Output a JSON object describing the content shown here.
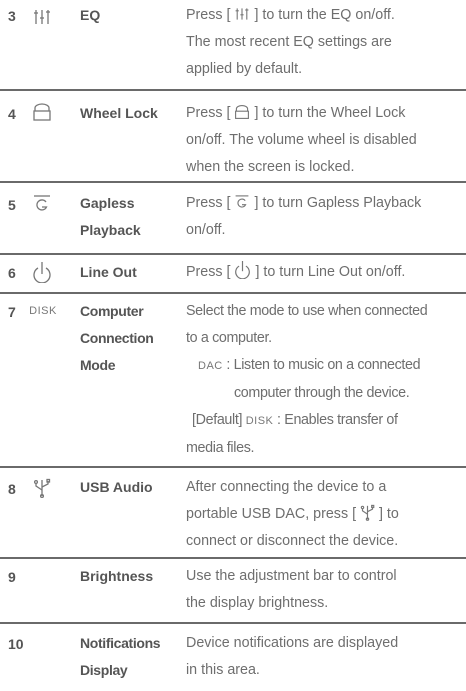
{
  "rows": [
    {
      "number": "3",
      "icon": "eq-icon",
      "label_lines": [
        "EQ"
      ],
      "description_lines": [
        {
          "before": "Press [ ",
          "icon": "eq-icon",
          "after": " ] to turn the EQ on/off."
        },
        {
          "text": "The most recent EQ settings are"
        },
        {
          "text": "applied by default."
        }
      ]
    },
    {
      "number": "4",
      "icon": "lock-icon",
      "label_lines": [
        "Wheel Lock"
      ],
      "description_lines": [
        {
          "before": "Press [ ",
          "icon": "lock-icon",
          "after": " ] to turn the Wheel Lock"
        },
        {
          "text": "on/off. The volume wheel is disabled"
        },
        {
          "text": "when the screen is locked."
        }
      ]
    },
    {
      "number": "5",
      "icon": "gapless-icon",
      "label_lines": [
        "Gapless",
        "Playback"
      ],
      "description_lines": [
        {
          "before": "Press [ ",
          "icon": "gapless-icon",
          "after": " ] to turn Gapless Playback"
        },
        {
          "text": "on/off."
        }
      ]
    },
    {
      "number": "6",
      "icon": "line-out-icon",
      "label_lines": [
        "Line Out"
      ],
      "description_lines": [
        {
          "before": "Press [ ",
          "icon": "line-out-icon",
          "after": " ] to turn Line Out on/off."
        }
      ]
    },
    {
      "number": "7",
      "icon_text": "DISK",
      "label_lines": [
        "Computer",
        "Connection",
        "Mode"
      ],
      "description_lines": [
        {
          "text": "Select the mode to use when connected"
        },
        {
          "text": "to a computer."
        },
        {
          "mode": "DAC",
          "text": " : Listen to music on a connected"
        },
        {
          "text": "computer through the device."
        },
        {
          "prefix": "[Default] ",
          "mode": "DISK",
          "text": " : Enables transfer of"
        },
        {
          "text": "media files."
        }
      ]
    },
    {
      "number": "8",
      "icon": "usb-icon",
      "label_lines": [
        "USB Audio"
      ],
      "description_lines": [
        {
          "text": "After connecting the device to a"
        },
        {
          "before": "portable USB DAC, press [ ",
          "icon": "usb-icon",
          "after": " ] to"
        },
        {
          "text": "connect or disconnect the device."
        }
      ]
    },
    {
      "number": "9",
      "label_lines": [
        "Brightness"
      ],
      "description_lines": [
        {
          "text": "Use the adjustment bar to control"
        },
        {
          "text": "the display brightness."
        }
      ]
    },
    {
      "number": "10",
      "label_lines": [
        "Notifications",
        "Display"
      ],
      "description_lines": [
        {
          "text": "Device notifications are displayed"
        },
        {
          "text": "in this area."
        }
      ]
    }
  ]
}
